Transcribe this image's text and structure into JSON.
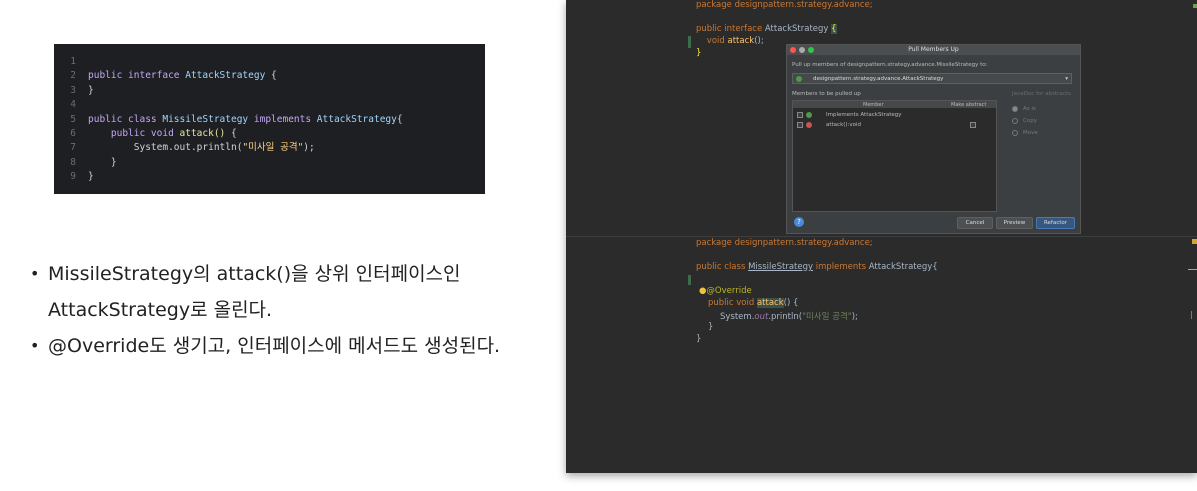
{
  "snippet": {
    "lines": [
      {
        "num": "1"
      },
      {
        "num": "2",
        "parts": [
          {
            "t": "public interface ",
            "c": "kw"
          },
          {
            "t": "AttackStrategy",
            "c": "ty"
          },
          {
            "t": " {",
            "c": ""
          }
        ]
      },
      {
        "num": "3",
        "parts": [
          {
            "t": "}",
            "c": ""
          }
        ]
      },
      {
        "num": "4"
      },
      {
        "num": "5",
        "parts": [
          {
            "t": "public class ",
            "c": "kw"
          },
          {
            "t": "MissileStrategy",
            "c": "ty"
          },
          {
            "t": " implements ",
            "c": "kw"
          },
          {
            "t": "AttackStrategy",
            "c": "ty"
          },
          {
            "t": "{",
            "c": ""
          }
        ]
      },
      {
        "num": "6",
        "parts": [
          {
            "t": "    public void ",
            "c": "kw"
          },
          {
            "t": "attack()",
            "c": "fn"
          },
          {
            "t": " {",
            "c": ""
          }
        ]
      },
      {
        "num": "7",
        "parts": [
          {
            "t": "        System.out.println(",
            "c": ""
          },
          {
            "t": "\"미사일 공격\"",
            "c": "st"
          },
          {
            "t": ");",
            "c": ""
          }
        ]
      },
      {
        "num": "8",
        "parts": [
          {
            "t": "    }",
            "c": ""
          }
        ]
      },
      {
        "num": "9",
        "parts": [
          {
            "t": "}",
            "c": ""
          }
        ]
      }
    ]
  },
  "bullets": {
    "b1": "MissileStrategy의 attack()을 상위 인터페이스인 AttackStrategy로  올린다.",
    "b2": "@Override도 생기고, 인터페이스에 메서드도 생성된다."
  },
  "ide": {
    "top_package": "package designpattern.strategy.advance;",
    "top_interface_kw": "public interface ",
    "top_interface_name": "AttackStrategy ",
    "top_brace": "{",
    "top_method_kw": "    void ",
    "top_method_name": "attack",
    "top_method_rest": "();",
    "top_close": "}",
    "lower_package": "package designpattern.strategy.advance;",
    "lower_class_kw": "public class ",
    "lower_class_name": "MissileStrategy",
    "lower_impl_kw": " implements ",
    "lower_impl_rest": "AttackStrategy{",
    "lower_override": "@Override",
    "lower_method_kw": "public void ",
    "lower_method_name": "attack",
    "lower_method_rest": "() {",
    "lower_print_a": "System.",
    "lower_print_out": "out",
    "lower_print_b": ".println(",
    "lower_print_str": "\"미사일 공격\"",
    "lower_print_c": ");",
    "lower_inner_close": "}",
    "lower_close": "}"
  },
  "dialog": {
    "title": "Pull Members Up",
    "pull_label": "Pull up members of designpattern.strategy.advance.MissileStrategy to:",
    "selected_target": "designpattern.strategy.advance.AttackStrategy",
    "members_label": "Members to be pulled up",
    "col_member": "Member",
    "col_abstract": "Make abstract",
    "member_1": "Implements AttackStrategy",
    "member_2": "attack():void",
    "javadoc_label": "JavaDoc for abstracts",
    "radio_asis": "As is",
    "radio_copy": "Copy",
    "radio_move": "Move",
    "btn_cancel": "Cancel",
    "btn_preview": "Preview",
    "btn_refactor": "Refactor",
    "help": "?"
  },
  "colors": {
    "ide_bg": "#2b2b2b",
    "keyword": "#cc7832",
    "string": "#6a8759",
    "method": "#ffc66d",
    "annotation": "#bbb529"
  }
}
